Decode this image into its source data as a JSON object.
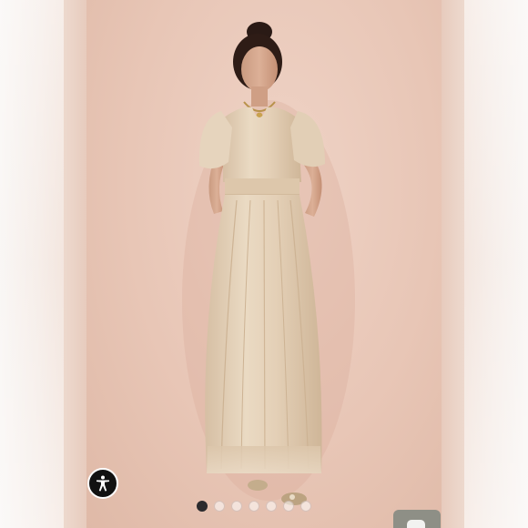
{
  "carousel": {
    "total_slides": 7,
    "active_index": 0
  },
  "accessibility": {
    "icon": "accessibility-person-icon"
  },
  "corner_button": {
    "icon": "chat-bubble-icon"
  },
  "colors": {
    "backdrop": "#e8c6b6",
    "dress": "#e3cdb2",
    "active_dot": "#2b2b2e",
    "a11y_button": "#111111",
    "corner_button": "#8e8f86"
  }
}
